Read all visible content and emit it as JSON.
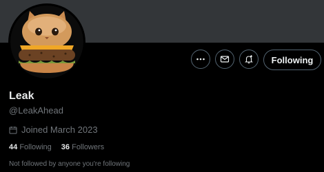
{
  "profile": {
    "display_name": "Leak",
    "handle": "@LeakAhead",
    "joined": "Joined March 2023",
    "following_count": "44",
    "following_label": "Following",
    "followers_count": "36",
    "followers_label": "Followers",
    "not_followed_text": "Not followed by anyone you're following"
  },
  "actions": {
    "more_icon": "more-horizontal-icon",
    "message_icon": "envelope-icon",
    "notify_icon": "bell-plus-icon",
    "follow_label": "Following"
  },
  "colors": {
    "background": "#000000",
    "banner": "#333639",
    "muted_text": "#71767b",
    "primary_text": "#e7e9ea"
  }
}
